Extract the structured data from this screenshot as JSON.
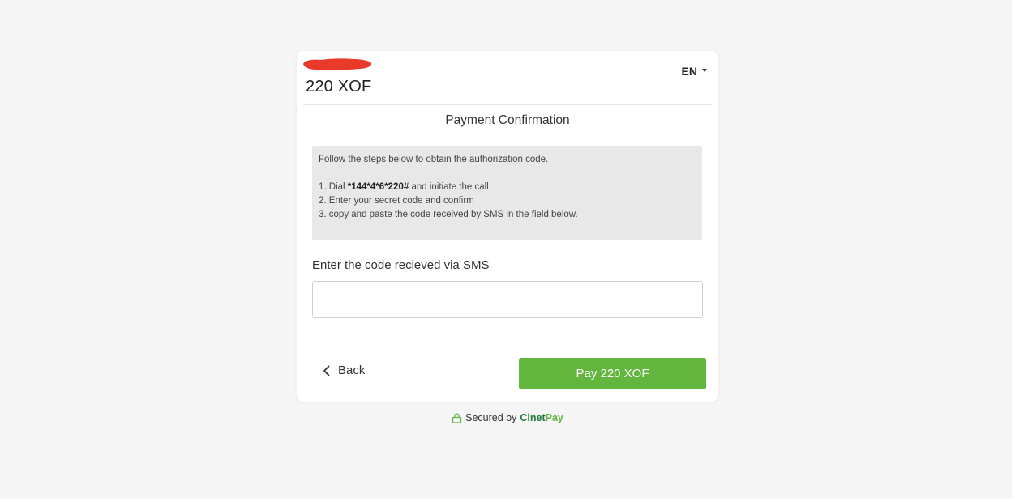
{
  "header": {
    "amount": "220 XOF",
    "language": "EN"
  },
  "title": "Payment Confirmation",
  "instructions": {
    "intro": "Follow the steps below to obtain the authorization code.",
    "step1_prefix": "1. Dial ",
    "step1_code": "*144*4*6*220#",
    "step1_suffix": " and initiate the call",
    "step2": "2. Enter your secret code and confirm",
    "step3": "3. copy and paste the code received by SMS in the field below."
  },
  "code_field": {
    "label": "Enter the code recieved via SMS",
    "value": "",
    "placeholder": ""
  },
  "actions": {
    "back_label": "Back",
    "pay_label": "Pay 220 XOF"
  },
  "footer": {
    "secured_label": "Secured by",
    "brand_part1": "Cinet",
    "brand_part2": "Pay"
  },
  "colors": {
    "accent": "#62b53d",
    "brand_dark": "#1c7a3a",
    "redaction": "#e8392b"
  },
  "icons": {
    "back": "chevron-left-icon",
    "secure": "lock-icon",
    "language": "caret-down-icon"
  }
}
